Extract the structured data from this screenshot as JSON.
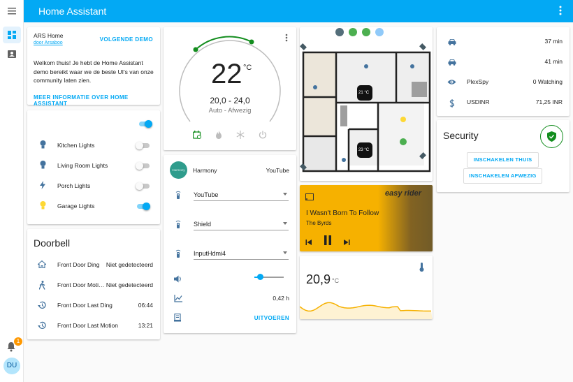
{
  "app": {
    "title": "Home Assistant"
  },
  "sidebar": {
    "notification_count": "1",
    "user_initials": "DU"
  },
  "welcome": {
    "name": "ARS Home",
    "author": "door Arsaboo",
    "next_demo": "VOLGENDE DEMO",
    "body": "Welkom thuis! Je hebt de Home Assistant demo bereikt waar we de beste UI's van onze community laten zien.",
    "more_info": "MEER INFORMATIE OVER HOME ASSISTANT"
  },
  "lights": {
    "master_on": true,
    "items": [
      {
        "label": "Kitchen Lights",
        "on": false,
        "icon": "bulb-icon",
        "color": "#44739e"
      },
      {
        "label": "Living Room Lights",
        "on": false,
        "icon": "bulb-icon",
        "color": "#44739e"
      },
      {
        "label": "Porch Lights",
        "on": false,
        "icon": "flash-icon",
        "color": "#44739e"
      },
      {
        "label": "Garage Lights",
        "on": true,
        "icon": "bulb-icon",
        "color": "#fdd835"
      }
    ]
  },
  "doorbell": {
    "title": "Doorbell",
    "items": [
      {
        "label": "Front Door Ding",
        "value": "Niet gedetecteerd",
        "icon": "home-icon"
      },
      {
        "label": "Front Door Moti…",
        "value": "Niet gedetecteerd",
        "icon": "walk-icon"
      },
      {
        "label": "Front Door Last Ding",
        "value": "06:44",
        "icon": "history-icon"
      },
      {
        "label": "Front Door Last Motion",
        "value": "13:21",
        "icon": "history-icon"
      }
    ]
  },
  "thermostat": {
    "temp": "22",
    "unit": "°C",
    "range": "20,0 - 24,0",
    "mode": "Auto - Afwezig",
    "arc_color": "#138d1e"
  },
  "harmony": {
    "name": "Harmony",
    "avatar_text": "Harmony",
    "activity": "YouTube",
    "selects": [
      "YouTube",
      "Shield",
      "InputHdmi4"
    ],
    "volume": 0.12,
    "duration": "0,42 h",
    "execute": "UITVOEREN"
  },
  "floorplan": {
    "temp_1": "21 °C",
    "temp_2": "23 °C"
  },
  "media": {
    "title": "I Wasn't Born To Follow",
    "artist": "The Byrds",
    "bg_color": "#f6b100",
    "art_text": "easy rider"
  },
  "sensor": {
    "value": "20,9",
    "unit": "°C",
    "line_color": "#f6b100"
  },
  "travel": {
    "items": [
      {
        "label": "",
        "value": "37 min",
        "icon": "car-icon"
      },
      {
        "label": "",
        "value": "41 min",
        "icon": "car-icon"
      },
      {
        "label": "PlexSpy",
        "value": "0 Watching",
        "icon": "eye-icon"
      },
      {
        "label": "USDINR",
        "value": "71,25 INR",
        "icon": "dollar-icon"
      }
    ]
  },
  "security": {
    "title": "Security",
    "arm_home": "INSCHAKELEN THUIS",
    "arm_away": "INSCHAKELEN AFWEZIG",
    "status_color": "#138d1e"
  }
}
